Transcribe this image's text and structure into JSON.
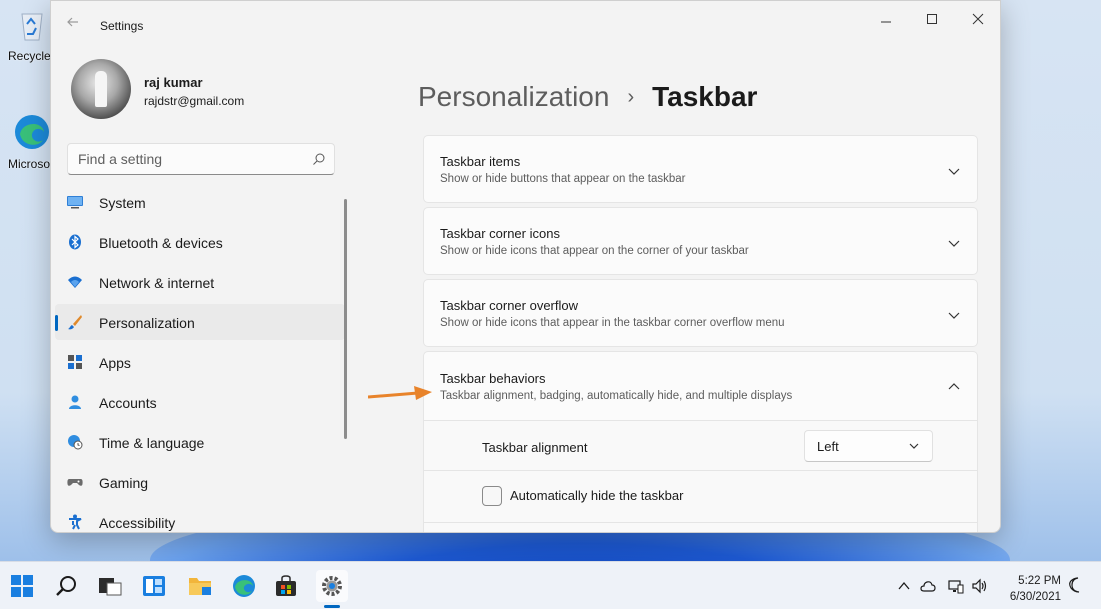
{
  "desktop": {
    "icons": [
      {
        "label": "Recycle Bin"
      },
      {
        "label": "Microsoft Edge"
      }
    ]
  },
  "window": {
    "title": "Settings",
    "back_icon": "arrow-left-icon",
    "controls": [
      "minimize-icon",
      "maximize-icon",
      "close-icon"
    ]
  },
  "profile": {
    "name": "raj kumar",
    "email": "rajdstr@gmail.com"
  },
  "search": {
    "placeholder": "Find a setting",
    "icon": "search-icon"
  },
  "nav": {
    "items": [
      {
        "label": "System",
        "icon": "monitor-icon",
        "active": false
      },
      {
        "label": "Bluetooth & devices",
        "icon": "bluetooth-icon",
        "active": false
      },
      {
        "label": "Network & internet",
        "icon": "wifi-icon",
        "active": false
      },
      {
        "label": "Personalization",
        "icon": "paintbrush-icon",
        "active": true
      },
      {
        "label": "Apps",
        "icon": "apps-icon",
        "active": false
      },
      {
        "label": "Accounts",
        "icon": "person-icon",
        "active": false
      },
      {
        "label": "Time & language",
        "icon": "globe-clock-icon",
        "active": false
      },
      {
        "label": "Gaming",
        "icon": "gamepad-icon",
        "active": false
      },
      {
        "label": "Accessibility",
        "icon": "accessibility-icon",
        "active": false
      }
    ]
  },
  "breadcrumb": {
    "parent": "Personalization",
    "separator": "›",
    "current": "Taskbar"
  },
  "sections": [
    {
      "title": "Taskbar items",
      "subtitle": "Show or hide buttons that appear on the taskbar",
      "expanded": false
    },
    {
      "title": "Taskbar corner icons",
      "subtitle": "Show or hide icons that appear on the corner of your taskbar",
      "expanded": false
    },
    {
      "title": "Taskbar corner overflow",
      "subtitle": "Show or hide icons that appear in the taskbar corner overflow menu",
      "expanded": false
    },
    {
      "title": "Taskbar behaviors",
      "subtitle": "Taskbar alignment, badging, automatically hide, and multiple displays",
      "expanded": true
    }
  ],
  "behaviors": {
    "alignment_label": "Taskbar alignment",
    "alignment_value": "Left",
    "autohide_label": "Automatically hide the taskbar",
    "autohide_checked": false
  },
  "annotation": {
    "arrow_color": "#e8832a"
  },
  "taskbar": {
    "apps": [
      "start-icon",
      "search-icon",
      "task-view-icon",
      "widgets-icon",
      "file-explorer-icon",
      "edge-icon",
      "store-icon",
      "settings-icon"
    ],
    "active_app": "settings-icon",
    "tray": [
      "chevron-up-icon",
      "cloud-icon",
      "network-icon",
      "volume-icon"
    ],
    "time": "5:22 PM",
    "date": "6/30/2021",
    "notification_icon": "moon-icon"
  },
  "colors": {
    "accent": "#0067c0",
    "window_bg": "#f3f3f3",
    "card_bg": "#fbfbfb"
  }
}
